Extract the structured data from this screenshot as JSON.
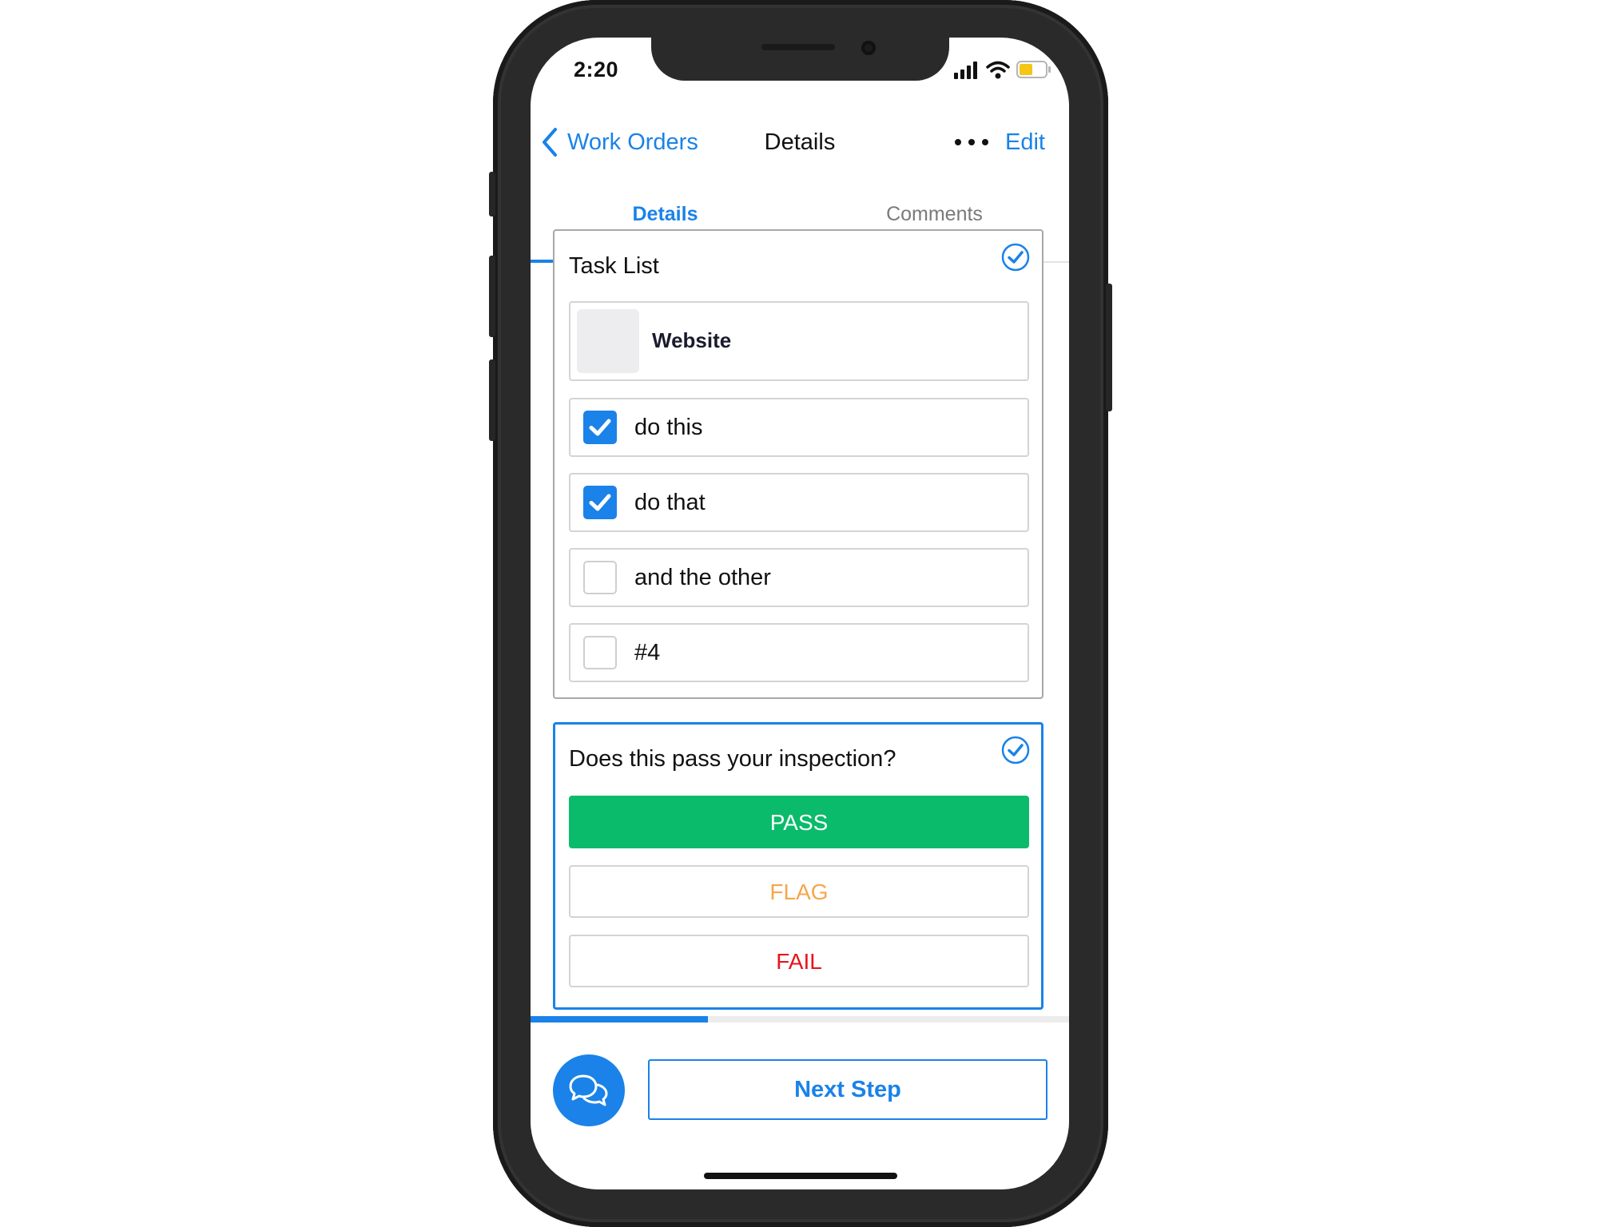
{
  "status_bar": {
    "time": "2:20",
    "battery_color": "#f5c518"
  },
  "nav": {
    "back_label": "Work Orders",
    "title": "Details",
    "edit_label": "Edit"
  },
  "tabs": [
    {
      "label": "Details",
      "active": true
    },
    {
      "label": "Comments",
      "active": false
    }
  ],
  "task_list": {
    "title": "Task List",
    "completed": true,
    "header_item": "Website",
    "items": [
      {
        "label": "do this",
        "checked": true
      },
      {
        "label": "do that",
        "checked": true
      },
      {
        "label": "and the other",
        "checked": false
      },
      {
        "label": "#4",
        "checked": false
      }
    ]
  },
  "inspection": {
    "question": "Does this pass your inspection?",
    "completed": true,
    "options": [
      {
        "label": "PASS",
        "selected": true
      },
      {
        "label": "FLAG",
        "selected": false
      },
      {
        "label": "FAIL",
        "selected": false
      }
    ]
  },
  "progress": {
    "fraction": 0.33
  },
  "footer": {
    "next_label": "Next Step"
  },
  "colors": {
    "accent": "#1a82e8",
    "pass": "#0abb6b",
    "flag": "#f5a74b",
    "fail": "#e8141c"
  }
}
